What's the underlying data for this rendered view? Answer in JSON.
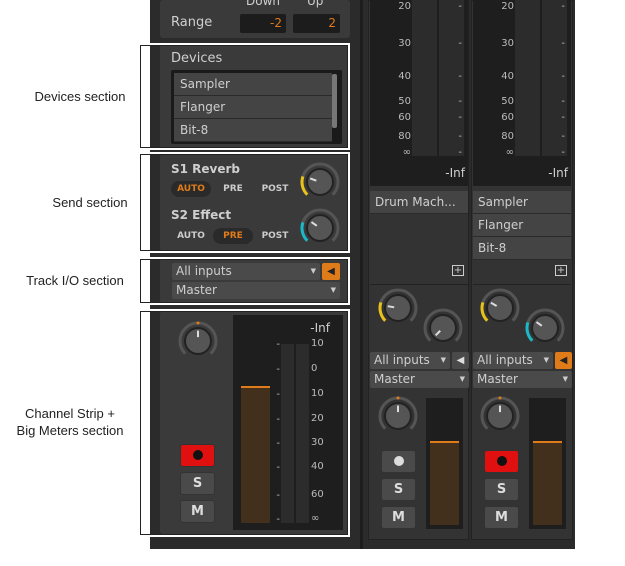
{
  "annotations": {
    "devices": "Devices section",
    "send": "Send section",
    "trackio": "Track I/O section",
    "channel_line1": "Channel Strip +",
    "channel_line2": "Big Meters section"
  },
  "inspector": {
    "range": {
      "header_down": "Down",
      "header_up": "Up",
      "label": "Range",
      "down": "-2",
      "up": "2"
    },
    "devices": {
      "title": "Devices",
      "items": [
        "Sampler",
        "Flanger",
        "Bit-8"
      ]
    },
    "sends": [
      {
        "name": "S1 Reverb",
        "modes": [
          "AUTO",
          "PRE",
          "POST"
        ],
        "active": "AUTO",
        "color": "#e8c21a"
      },
      {
        "name": "S2 Effect",
        "modes": [
          "AUTO",
          "PRE",
          "POST"
        ],
        "active": "PRE",
        "color": "#1ab8c8"
      }
    ],
    "io": {
      "input": "All inputs",
      "output": "Master",
      "monitor_on": true
    },
    "strip": {
      "peak": "-Inf",
      "scale": [
        "10",
        "0",
        "10",
        "20",
        "30",
        "40",
        "60",
        "∞"
      ],
      "level_percent": 72,
      "record_armed": true,
      "solo": "S",
      "mute": "M"
    }
  },
  "tracks": [
    {
      "scale": [
        "20",
        "30",
        "40",
        "50",
        "60",
        "80",
        "∞"
      ],
      "peak": "-Inf",
      "devices": [
        "Drum Mach..."
      ],
      "input": "All inputs",
      "output": "Master",
      "monitor_on": false,
      "record_armed": false,
      "solo": "S",
      "mute": "M"
    },
    {
      "scale": [
        "20",
        "30",
        "40",
        "50",
        "60",
        "80",
        "∞"
      ],
      "peak": "-Inf",
      "devices": [
        "Sampler",
        "Flanger",
        "Bit-8"
      ],
      "input": "All inputs",
      "output": "Master",
      "monitor_on": true,
      "record_armed": true,
      "solo": "S",
      "mute": "M"
    }
  ],
  "colors": {
    "accent": "#e07b1a",
    "record": "#e01010",
    "send1": "#e8c21a",
    "send2": "#1ab8c8"
  }
}
